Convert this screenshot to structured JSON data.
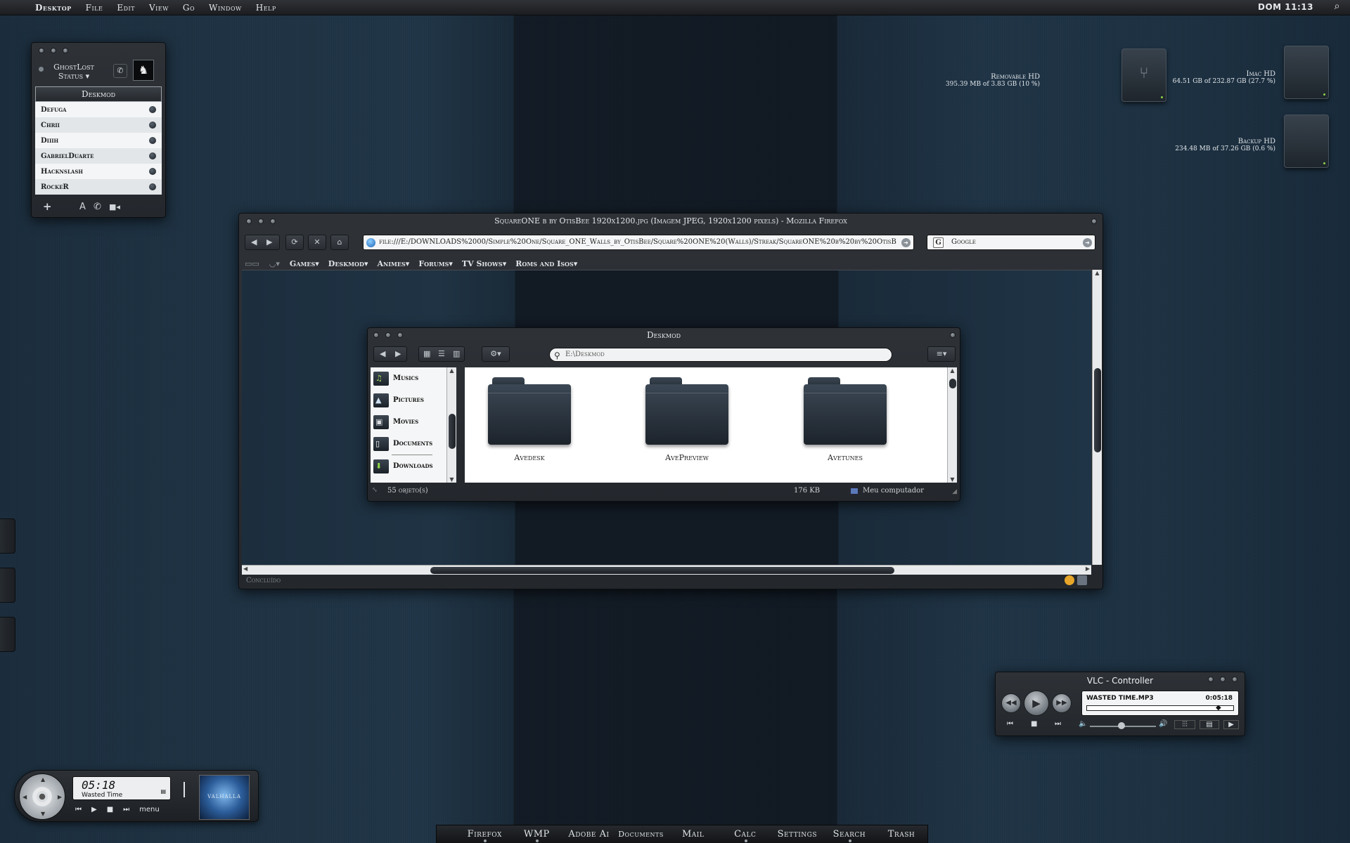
{
  "menubar": {
    "items": [
      "Desktop",
      "File",
      "Edit",
      "View",
      "Go",
      "Window",
      "Help"
    ],
    "clock": "DOM 11:13"
  },
  "messenger": {
    "username": "GhostLost",
    "status_label": "Status",
    "group_name": "Deskmod",
    "contacts": [
      "Defuga",
      "Chrii",
      "Diiih",
      "GabrielDuarte",
      "Hacknslash",
      "RockeR"
    ]
  },
  "drives": [
    {
      "name": "Removable HD",
      "info": "395.39 MB of 3.83 GB (10 %)"
    },
    {
      "name": "Imac HD",
      "info": "64.51 GB of 232.87 GB (27.7 %)"
    },
    {
      "name": "Backup HD",
      "info": "234.48 MB of 37.26 GB (0.6 %)"
    }
  ],
  "firefox": {
    "title": "SquareONE b by OtisBee 1920x1200.jpg (Imagem JPEG, 1920x1200 pixels) - Mozilla Firefox",
    "url": "file:///E:/DOWNLOADS%2000/Simple%20One/Square_ONE_Walls_by_OtisBee/Square%20ONE%20(Walls)/Streak/SquareONE%20b%20by%20OtisB",
    "search_engine": "Google",
    "bookmarks": [
      "Games",
      "Deskmod",
      "Animes",
      "Forums",
      "TV Shows",
      "Roms and Isos"
    ],
    "status": "Concluído"
  },
  "finder": {
    "title": "Deskmod",
    "path": "E:\\Deskmod",
    "sidebar": [
      "Musics",
      "Pictures",
      "Movies",
      "Documents",
      "Downloads"
    ],
    "folders": [
      "Avedesk",
      "AvePreview",
      "Avetunes"
    ],
    "status_count": "55 objeto(s)",
    "status_size": "176 KB",
    "status_location": "Meu computador"
  },
  "vlc": {
    "title": "VLC - Controller",
    "track": "WASTED TIME.MP3",
    "time": "0:05:18",
    "progress": 0.9
  },
  "mini_player": {
    "time": "05:18",
    "song": "Wasted Time",
    "menu_label": "menu",
    "album_text": "VALHALLA"
  },
  "dock": {
    "items": [
      "Firefox",
      "WMP",
      "Adobe Ai",
      "Documents",
      "Mail",
      "Calc",
      "Settings",
      "Search",
      "Trash"
    ]
  }
}
